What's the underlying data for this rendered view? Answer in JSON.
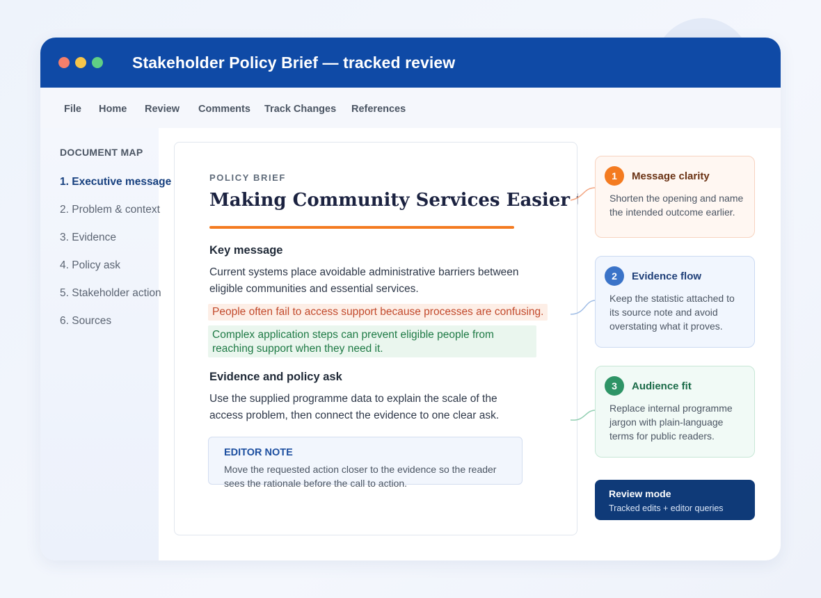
{
  "window": {
    "title": "Stakeholder Policy Brief — tracked review"
  },
  "menu": [
    "File",
    "Home",
    "Review",
    "Comments",
    "Track Changes",
    "References"
  ],
  "sidebar": {
    "heading": "DOCUMENT MAP",
    "items": [
      "1. Executive message",
      "2. Problem & context",
      "3. Evidence",
      "4. Policy ask",
      "5. Stakeholder action",
      "6. Sources"
    ],
    "active_index": 0
  },
  "document": {
    "eyebrow": "POLICY BRIEF",
    "title": "Making Community Services Easier to Access",
    "key_message_heading": "Key message",
    "key_message_text": "Current systems place avoidable administrative barriers between eligible communities and essential services.",
    "deleted_text": "People often fail to access support because processes are confusing.",
    "inserted_text": "Complex application steps can prevent eligible people from reaching support when they need it.",
    "evidence_heading": "Evidence and policy ask",
    "evidence_text": "Use the supplied programme data to explain the scale of the access problem, then connect the evidence to one clear ask.",
    "editor_note": {
      "title": "EDITOR NOTE",
      "text": "Move the requested action closer to the evidence so the reader sees the rationale before the call to action."
    }
  },
  "comments": [
    {
      "number": "1",
      "title": "Message clarity",
      "text": "Shorten the opening and name the intended outcome earlier."
    },
    {
      "number": "2",
      "title": "Evidence flow",
      "text": "Keep the statistic attached to its source note and avoid overstating what it proves."
    },
    {
      "number": "3",
      "title": "Audience fit",
      "text": "Replace internal programme jargon with plain-language terms for public readers."
    }
  ],
  "review_mode": {
    "title": "Review mode",
    "subtitle": "Tracked edits + editor queries"
  },
  "colors": {
    "titlebar": "#0f4aa6",
    "accent_orange": "#f47b20",
    "deleted": "#c2492b",
    "inserted": "#1e7a45",
    "comment_blue": "#3a73c8",
    "comment_green": "#2e9466"
  }
}
